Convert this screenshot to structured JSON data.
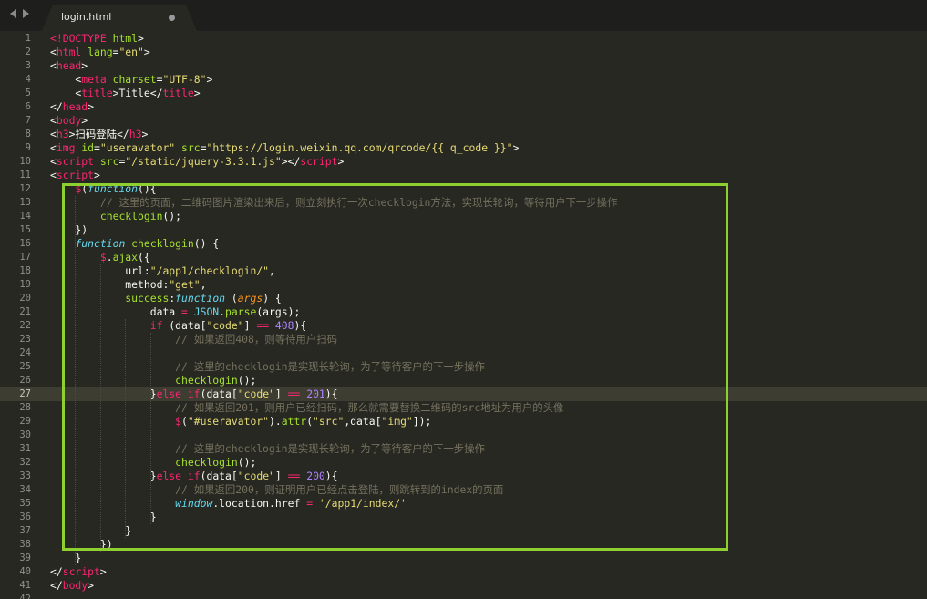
{
  "tab": {
    "title": "login.html"
  },
  "colors": {
    "tag": "#f92672",
    "attr": "#a6e22e",
    "string": "#e6db74",
    "comment": "#75715e",
    "number": "#ae81ff",
    "storage": "#66d9ef",
    "param": "#fd971f",
    "highlight_box": "#8ed02f"
  },
  "editor": {
    "current_line": 27,
    "lines": [
      {
        "n": "1",
        "t": [
          [
            "&lt;!",
            "tag"
          ],
          [
            "DOCTYPE",
            "tag"
          ],
          [
            " html",
            "attr"
          ],
          [
            "&gt;",
            "text"
          ]
        ]
      },
      {
        "n": "2",
        "t": [
          [
            "<",
            "text"
          ],
          [
            "html",
            "tag"
          ],
          [
            " lang",
            "attr"
          ],
          [
            "=",
            "text"
          ],
          [
            "\"en\"",
            "str"
          ],
          [
            ">",
            "text"
          ]
        ]
      },
      {
        "n": "3",
        "t": [
          [
            "<",
            "text"
          ],
          [
            "head",
            "tag"
          ],
          [
            ">",
            "text"
          ]
        ]
      },
      {
        "n": "4",
        "t": [
          [
            "    <",
            "text"
          ],
          [
            "meta",
            "tag"
          ],
          [
            " charset",
            "attr"
          ],
          [
            "=",
            "text"
          ],
          [
            "\"UTF-8\"",
            "str"
          ],
          [
            ">",
            "text"
          ]
        ]
      },
      {
        "n": "5",
        "t": [
          [
            "    <",
            "text"
          ],
          [
            "title",
            "tag"
          ],
          [
            ">Title</",
            "text"
          ],
          [
            "title",
            "tag"
          ],
          [
            ">",
            "text"
          ]
        ]
      },
      {
        "n": "6",
        "t": [
          [
            "</",
            "text"
          ],
          [
            "head",
            "tag"
          ],
          [
            ">",
            "text"
          ]
        ]
      },
      {
        "n": "7",
        "t": [
          [
            "<",
            "text"
          ],
          [
            "body",
            "tag"
          ],
          [
            ">",
            "text"
          ]
        ]
      },
      {
        "n": "8",
        "t": [
          [
            "<",
            "text"
          ],
          [
            "h3",
            "tag"
          ],
          [
            ">扫码登陆</",
            "text"
          ],
          [
            "h3",
            "tag"
          ],
          [
            ">",
            "text"
          ]
        ]
      },
      {
        "n": "9",
        "t": [
          [
            "<",
            "text"
          ],
          [
            "img",
            "tag"
          ],
          [
            " id",
            "attr"
          ],
          [
            "=",
            "text"
          ],
          [
            "\"useravator\"",
            "str"
          ],
          [
            " src",
            "attr"
          ],
          [
            "=",
            "text"
          ],
          [
            "\"https://login.weixin.qq.com/qrcode/{{ q_code }}\"",
            "str"
          ],
          [
            ">",
            "text"
          ]
        ]
      },
      {
        "n": "10",
        "t": [
          [
            "<",
            "text"
          ],
          [
            "script",
            "tag"
          ],
          [
            " src",
            "attr"
          ],
          [
            "=",
            "text"
          ],
          [
            "\"/static/jquery-3.3.1.js\"",
            "str"
          ],
          [
            "></",
            "text"
          ],
          [
            "script",
            "tag"
          ],
          [
            ">",
            "text"
          ]
        ]
      },
      {
        "n": "11",
        "t": [
          [
            "<",
            "text"
          ],
          [
            "script",
            "tag"
          ],
          [
            ">",
            "text"
          ]
        ]
      },
      {
        "n": "12",
        "t": [
          [
            "    ",
            "text"
          ],
          [
            "$",
            "kw"
          ],
          [
            "(",
            "text"
          ],
          [
            "function",
            "storage"
          ],
          [
            "(){",
            "text"
          ]
        ]
      },
      {
        "n": "13",
        "t": [
          [
            "        ",
            "text"
          ],
          [
            "// 这里的页面，二维码图片渲染出来后，则立刻执行一次checklogin方法，实现长轮询，等待用户下一步操作",
            "cmt"
          ]
        ]
      },
      {
        "n": "14",
        "t": [
          [
            "        ",
            "text"
          ],
          [
            "checklogin",
            "fn"
          ],
          [
            "();",
            "text"
          ]
        ]
      },
      {
        "n": "15",
        "t": [
          [
            "    })",
            "text"
          ]
        ]
      },
      {
        "n": "16",
        "t": [
          [
            "    ",
            "text"
          ],
          [
            "function",
            "storage"
          ],
          [
            " ",
            "text"
          ],
          [
            "checklogin",
            "fn"
          ],
          [
            "() {",
            "text"
          ]
        ]
      },
      {
        "n": "17",
        "t": [
          [
            "        ",
            "text"
          ],
          [
            "$",
            "kw"
          ],
          [
            ".",
            "text"
          ],
          [
            "ajax",
            "prop"
          ],
          [
            "({",
            "text"
          ]
        ]
      },
      {
        "n": "18",
        "t": [
          [
            "            url:",
            "text"
          ],
          [
            "\"/app1/checklogin/\"",
            "str"
          ],
          [
            ",",
            "text"
          ]
        ]
      },
      {
        "n": "19",
        "t": [
          [
            "            method:",
            "text"
          ],
          [
            "\"get\"",
            "str"
          ],
          [
            ",",
            "text"
          ]
        ]
      },
      {
        "n": "20",
        "t": [
          [
            "            ",
            "text"
          ],
          [
            "success",
            "fn"
          ],
          [
            ":",
            "text"
          ],
          [
            "function",
            "storage"
          ],
          [
            " (",
            "text"
          ],
          [
            "args",
            "param"
          ],
          [
            ") {",
            "text"
          ]
        ]
      },
      {
        "n": "21",
        "t": [
          [
            "                data ",
            "text"
          ],
          [
            "=",
            "kw"
          ],
          [
            " ",
            "text"
          ],
          [
            "JSON",
            "builtin"
          ],
          [
            ".",
            "text"
          ],
          [
            "parse",
            "prop"
          ],
          [
            "(args);",
            "text"
          ]
        ]
      },
      {
        "n": "22",
        "t": [
          [
            "                ",
            "text"
          ],
          [
            "if",
            "kw"
          ],
          [
            " (data[",
            "text"
          ],
          [
            "\"code\"",
            "str"
          ],
          [
            "] ",
            "text"
          ],
          [
            "==",
            "kw"
          ],
          [
            " ",
            "text"
          ],
          [
            "408",
            "num"
          ],
          [
            "){",
            "text"
          ]
        ]
      },
      {
        "n": "23",
        "t": [
          [
            "                    ",
            "text"
          ],
          [
            "// 如果返回408，则等待用户扫码",
            "cmt"
          ]
        ]
      },
      {
        "n": "24",
        "t": [
          [
            "",
            "text"
          ]
        ]
      },
      {
        "n": "25",
        "t": [
          [
            "                    ",
            "text"
          ],
          [
            "// 这里的checklogin是实现长轮询，为了等待客户的下一步操作",
            "cmt"
          ]
        ]
      },
      {
        "n": "26",
        "t": [
          [
            "                    ",
            "text"
          ],
          [
            "checklogin",
            "fn"
          ],
          [
            "();",
            "text"
          ]
        ]
      },
      {
        "n": "27",
        "t": [
          [
            "                }",
            "text"
          ],
          [
            "else",
            "kw"
          ],
          [
            " ",
            "text"
          ],
          [
            "if",
            "kw"
          ],
          [
            "(data[",
            "text"
          ],
          [
            "\"code\"",
            "str"
          ],
          [
            "] ",
            "text"
          ],
          [
            "==",
            "kw"
          ],
          [
            " ",
            "text"
          ],
          [
            "201",
            "num"
          ],
          [
            "){",
            "text"
          ]
        ]
      },
      {
        "n": "28",
        "t": [
          [
            "                    ",
            "text"
          ],
          [
            "// 如果返回201，则用户已经扫码，那么就需要替换二维码的src地址为用户的头像",
            "cmt"
          ]
        ]
      },
      {
        "n": "29",
        "t": [
          [
            "                    ",
            "text"
          ],
          [
            "$",
            "kw"
          ],
          [
            "(",
            "text"
          ],
          [
            "\"#useravator\"",
            "str"
          ],
          [
            ").",
            "text"
          ],
          [
            "attr",
            "prop"
          ],
          [
            "(",
            "text"
          ],
          [
            "\"src\"",
            "str"
          ],
          [
            ",data[",
            "text"
          ],
          [
            "\"img\"",
            "str"
          ],
          [
            "]);",
            "text"
          ]
        ]
      },
      {
        "n": "30",
        "t": [
          [
            "",
            "text"
          ]
        ]
      },
      {
        "n": "31",
        "t": [
          [
            "                    ",
            "text"
          ],
          [
            "// 这里的checklogin是实现长轮询，为了等待客户的下一步操作",
            "cmt"
          ]
        ]
      },
      {
        "n": "32",
        "t": [
          [
            "                    ",
            "text"
          ],
          [
            "checklogin",
            "fn"
          ],
          [
            "();",
            "text"
          ]
        ]
      },
      {
        "n": "33",
        "t": [
          [
            "                }",
            "text"
          ],
          [
            "else",
            "kw"
          ],
          [
            " ",
            "text"
          ],
          [
            "if",
            "kw"
          ],
          [
            "(data[",
            "text"
          ],
          [
            "\"code\"",
            "str"
          ],
          [
            "] ",
            "text"
          ],
          [
            "==",
            "kw"
          ],
          [
            " ",
            "text"
          ],
          [
            "200",
            "num"
          ],
          [
            "){",
            "text"
          ]
        ]
      },
      {
        "n": "34",
        "t": [
          [
            "                    ",
            "text"
          ],
          [
            "// 如果返回200，则证明用户已经点击登陆，则跳转到的index的页面",
            "cmt"
          ]
        ]
      },
      {
        "n": "35",
        "t": [
          [
            "                    ",
            "text"
          ],
          [
            "window",
            "storage"
          ],
          [
            ".location.href ",
            "text"
          ],
          [
            "=",
            "kw"
          ],
          [
            " ",
            "text"
          ],
          [
            "'/app1/index/'",
            "str"
          ]
        ]
      },
      {
        "n": "36",
        "t": [
          [
            "                }",
            "text"
          ]
        ]
      },
      {
        "n": "37",
        "t": [
          [
            "            }",
            "text"
          ]
        ]
      },
      {
        "n": "38",
        "t": [
          [
            "        })",
            "text"
          ]
        ]
      },
      {
        "n": "39",
        "t": [
          [
            "    }",
            "text"
          ]
        ]
      },
      {
        "n": "40",
        "t": [
          [
            "</",
            "text"
          ],
          [
            "script",
            "tag"
          ],
          [
            ">",
            "text"
          ]
        ]
      },
      {
        "n": "41",
        "t": [
          [
            "</",
            "text"
          ],
          [
            "body",
            "tag"
          ],
          [
            ">",
            "text"
          ]
        ]
      },
      {
        "n": "42",
        "t": [
          [
            "",
            "text"
          ]
        ]
      }
    ]
  }
}
